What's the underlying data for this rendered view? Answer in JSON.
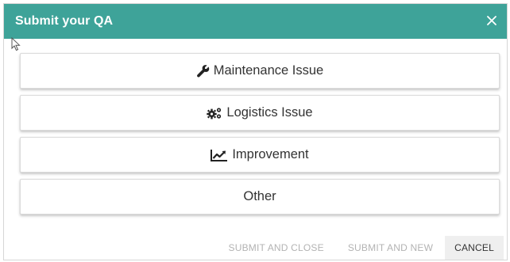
{
  "dialog": {
    "title": "Submit your QA",
    "close_glyph": "✕"
  },
  "options": [
    {
      "label": "Maintenance Issue",
      "icon": "wrench-icon"
    },
    {
      "label": "Logistics Issue",
      "icon": "gears-icon"
    },
    {
      "label": "Improvement",
      "icon": "line-chart-icon"
    },
    {
      "label": "Other",
      "icon": ""
    }
  ],
  "footer": {
    "submit_close_label": "SUBMIT AND CLOSE",
    "submit_new_label": "SUBMIT AND NEW",
    "cancel_label": "CANCEL"
  },
  "colors": {
    "header": "#3ea399",
    "disabled_text": "#b3b3b3",
    "cancel_bg": "#efefef"
  }
}
